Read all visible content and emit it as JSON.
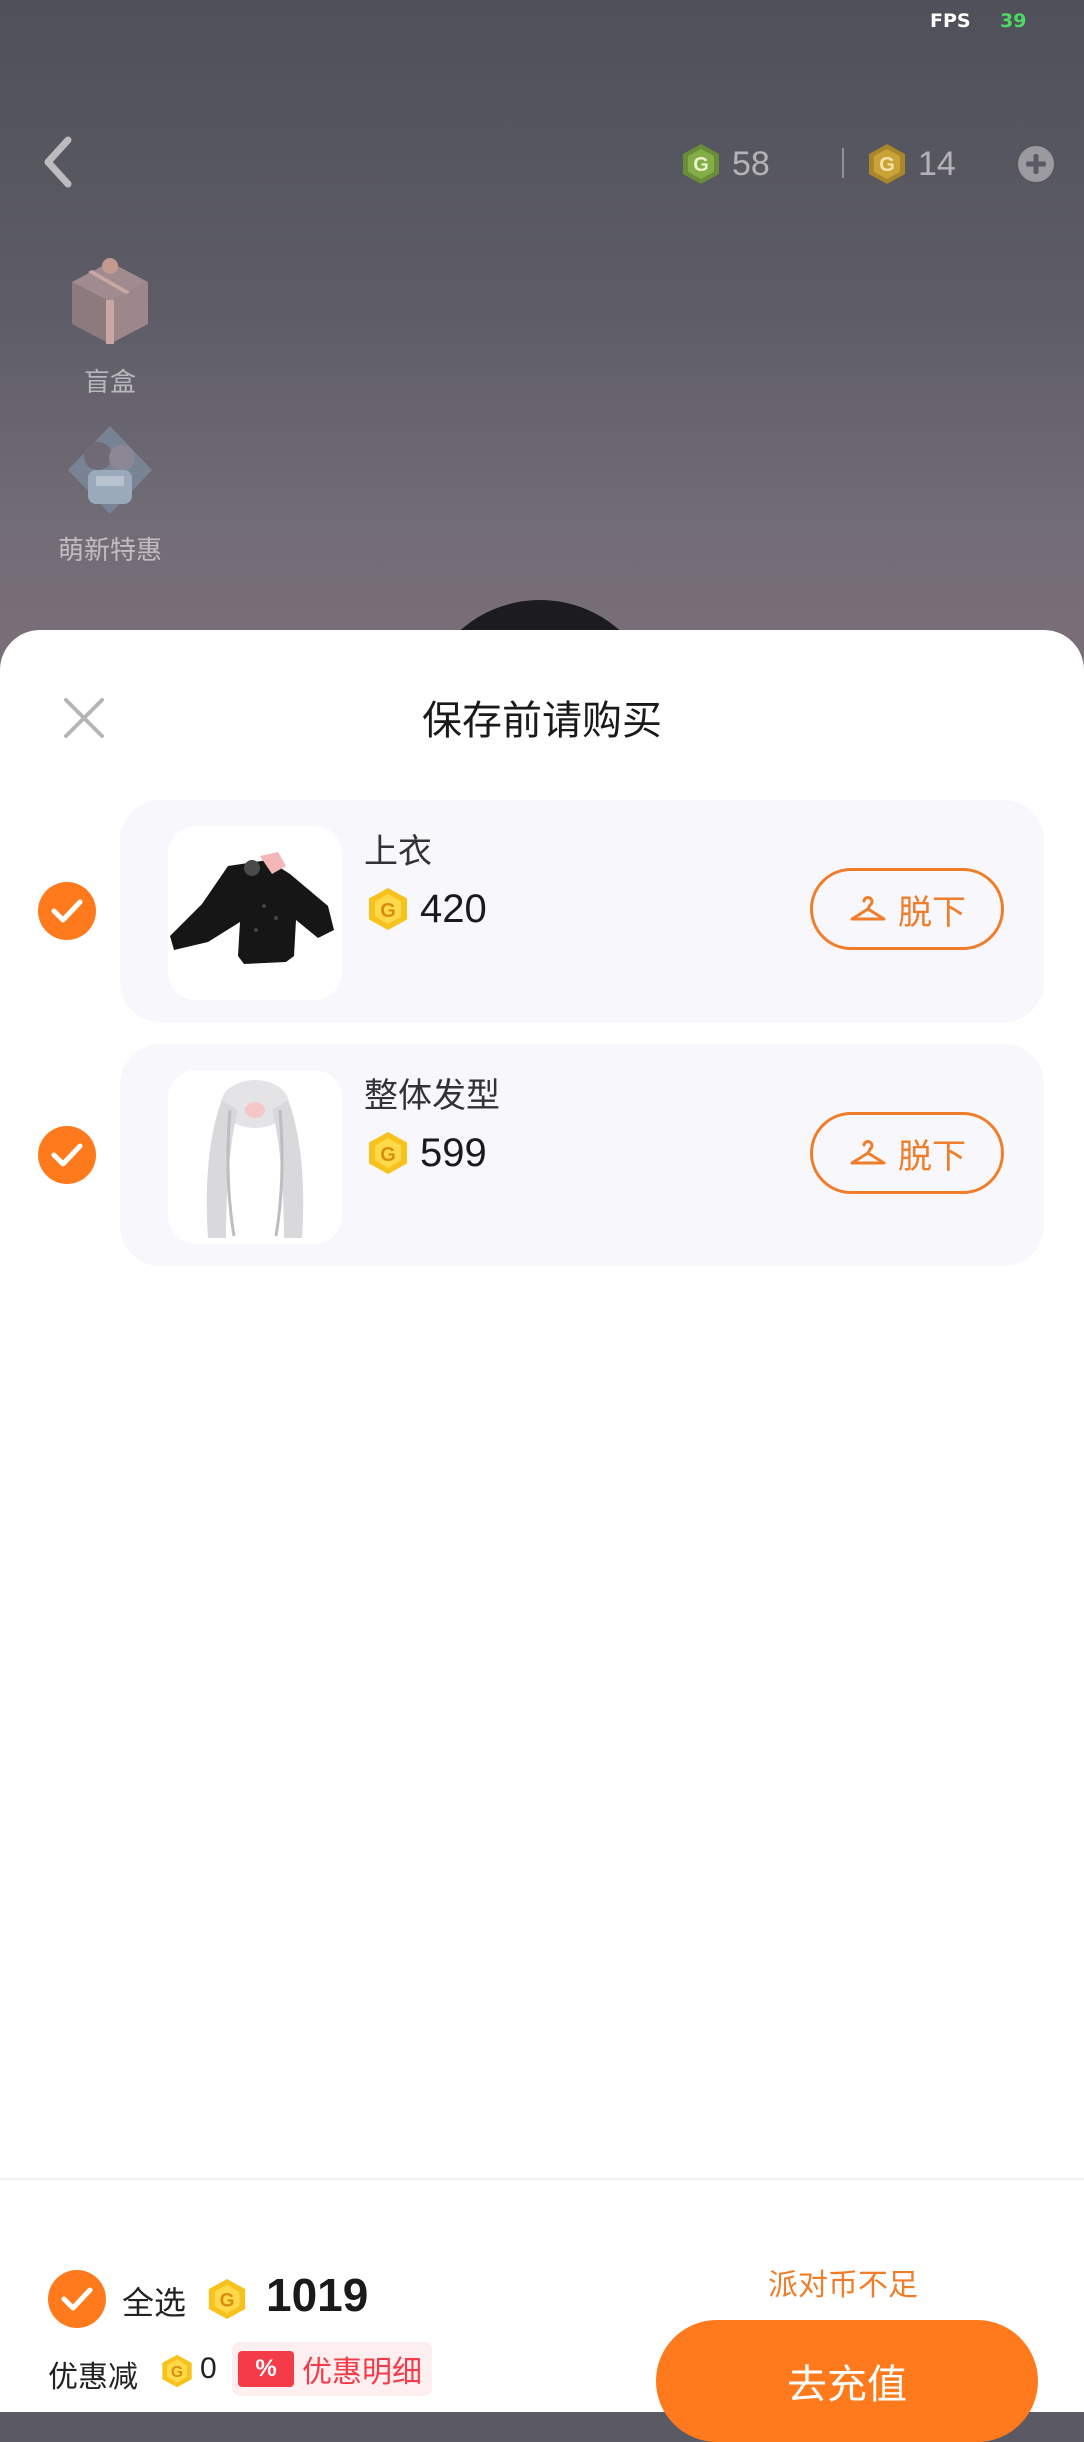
{
  "status": {
    "fps_label": "FPS",
    "fps_value": "39"
  },
  "header": {
    "currency_green": {
      "value": "58",
      "icon": "green-g-coin-icon"
    },
    "currency_gold": {
      "value": "14",
      "icon": "gold-g-coin-icon"
    }
  },
  "side_buttons": [
    {
      "label": "盲盒",
      "icon": "blind-box-gift-icon"
    },
    {
      "label": "萌新特惠",
      "icon": "newbie-offer-icon"
    }
  ],
  "modal": {
    "title": "保存前请购买",
    "items": [
      {
        "name": "上衣",
        "price": "420",
        "action": "脱下",
        "checked": true
      },
      {
        "name": "整体发型",
        "price": "599",
        "action": "脱下",
        "checked": true
      }
    ]
  },
  "footer": {
    "select_all_label": "全选",
    "total": "1019",
    "discount_label": "优惠减",
    "discount_value": "0",
    "discount_tag": "%",
    "discount_detail": "优惠明细",
    "warning": "派对币不足",
    "recharge_label": "去充值"
  },
  "colors": {
    "accent": "#ff7a1c",
    "coin_gold": "#f6c21b",
    "discount_red": "#f43b4a"
  }
}
